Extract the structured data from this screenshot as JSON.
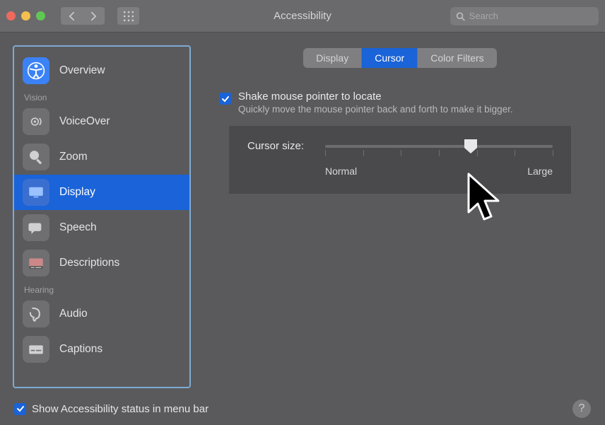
{
  "window": {
    "title": "Accessibility"
  },
  "search": {
    "placeholder": "Search"
  },
  "sidebar": {
    "sections": {
      "vision": "Vision",
      "hearing": "Hearing"
    },
    "items": {
      "overview": "Overview",
      "voiceover": "VoiceOver",
      "zoom": "Zoom",
      "display": "Display",
      "speech": "Speech",
      "descriptions": "Descriptions",
      "audio": "Audio",
      "captions": "Captions"
    },
    "selected": "display"
  },
  "tabs": {
    "display": "Display",
    "cursor": "Cursor",
    "color_filters": "Color Filters",
    "selected": "cursor"
  },
  "options": {
    "shake": {
      "checked": true,
      "label": "Shake mouse pointer to locate",
      "description": "Quickly move the mouse pointer back and forth to make it bigger."
    }
  },
  "slider": {
    "label": "Cursor size:",
    "min_label": "Normal",
    "max_label": "Large",
    "ticks": 7,
    "value_pct": 64
  },
  "bottom": {
    "show_status": {
      "checked": true,
      "label": "Show Accessibility status in menu bar"
    }
  },
  "colors": {
    "accent": "#1a63d8",
    "highlight_border": "#7eaad4"
  }
}
